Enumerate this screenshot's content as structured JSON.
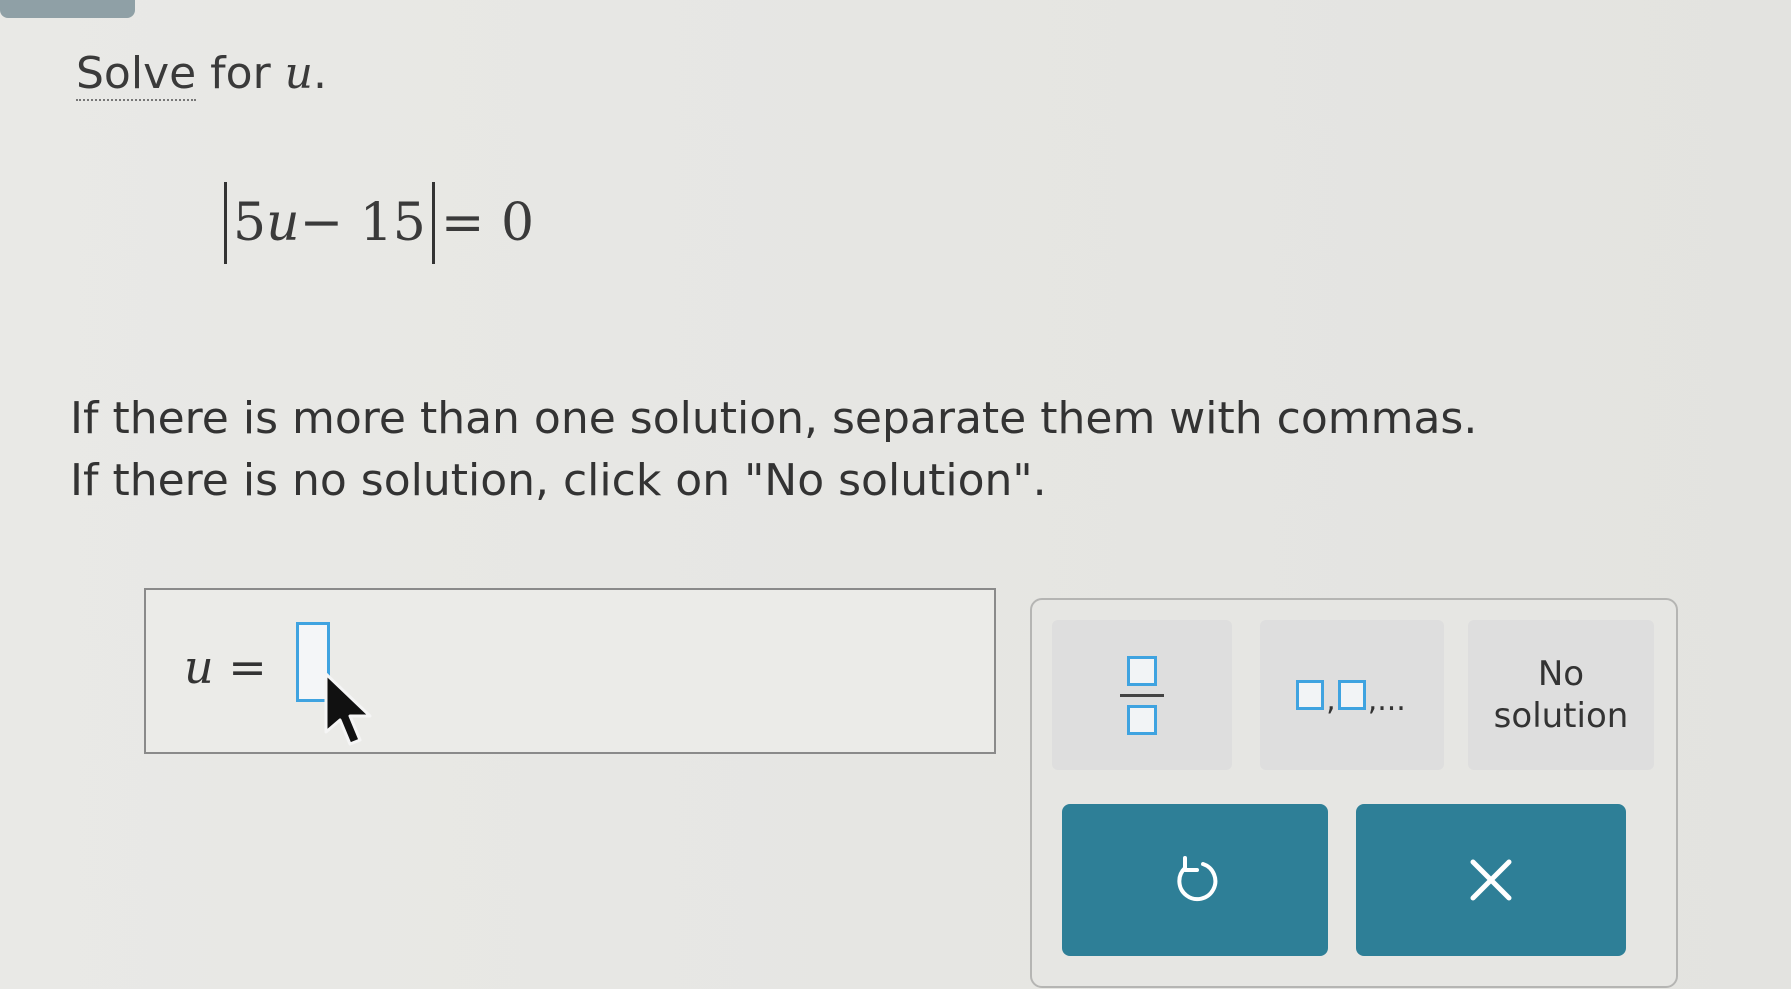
{
  "prompt": {
    "link_text": "Solve",
    "rest_text": " for ",
    "variable": "u",
    "period": "."
  },
  "equation": {
    "inner": "5",
    "inner_var": "u",
    "inner_rest": " − 15",
    "rhs": "= 0"
  },
  "instructions": {
    "line1": "If there is more than one solution, separate them with commas.",
    "line2": "If there is no solution, click on \"No solution\"."
  },
  "answer": {
    "variable": "u",
    "equals": " ="
  },
  "keypad": {
    "list_ellipsis": ",...",
    "list_comma": ",",
    "no_solution_line1": "No",
    "no_solution_line2": "solution"
  },
  "colors": {
    "accent": "#2e7f97",
    "slot_border": "#3fa3e0"
  }
}
